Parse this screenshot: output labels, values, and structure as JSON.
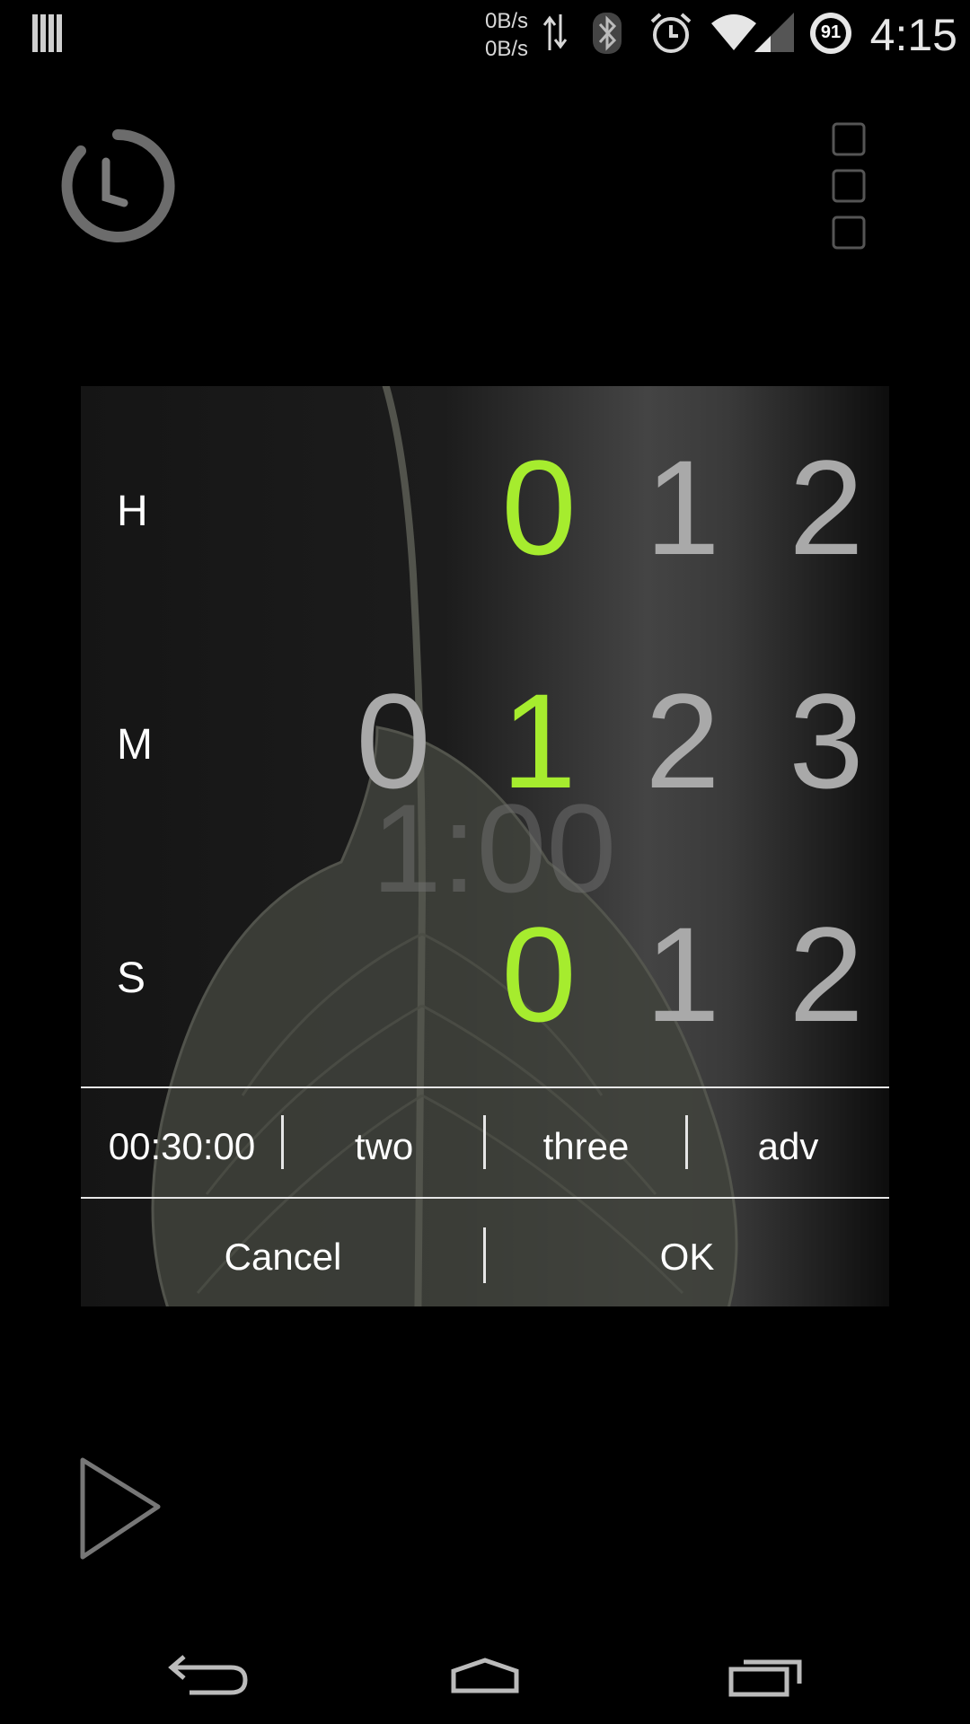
{
  "status_bar": {
    "upload_speed": "0B/s",
    "download_speed": "0B/s",
    "battery_level": "91",
    "time": "4:15"
  },
  "picker": {
    "hours": {
      "label": "H",
      "digits": [
        "0",
        "1",
        "2"
      ],
      "selected": "0"
    },
    "minutes": {
      "label": "M",
      "digits": [
        "0",
        "1",
        "2",
        "3"
      ],
      "selected": "1"
    },
    "seconds": {
      "label": "S",
      "digits": [
        "0",
        "1",
        "2"
      ],
      "selected": "0"
    },
    "readout": "1:00"
  },
  "presets": [
    "00:30:00",
    "two",
    "three",
    "adv"
  ],
  "actions": {
    "cancel": "Cancel",
    "ok": "OK"
  },
  "colors": {
    "accent": "#a6ec2e",
    "unselected_digit": "#a9a9a9"
  }
}
